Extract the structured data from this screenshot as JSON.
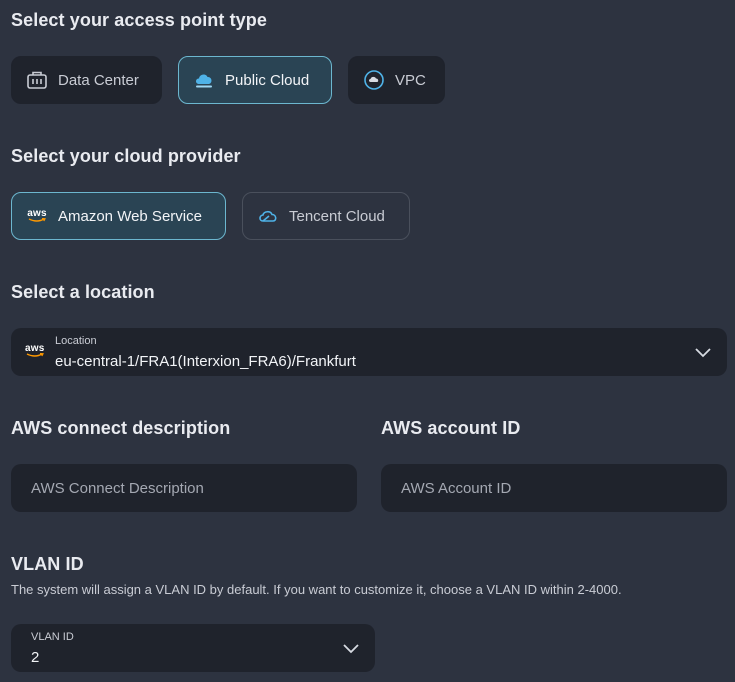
{
  "access_point": {
    "title": "Select your access point type",
    "options": [
      {
        "label": "Data Center",
        "icon": "building-icon"
      },
      {
        "label": "Public Cloud",
        "icon": "cloud-icon",
        "selected": true
      },
      {
        "label": "VPC",
        "icon": "vpc-icon"
      }
    ]
  },
  "cloud_provider": {
    "title": "Select your cloud provider",
    "options": [
      {
        "label": "Amazon Web Service",
        "icon": "aws-logo-icon",
        "selected": true
      },
      {
        "label": "Tencent Cloud",
        "icon": "tencent-cloud-icon"
      }
    ]
  },
  "location": {
    "title": "Select a location",
    "field_label": "Location",
    "value": "eu-central-1/FRA1(Interxion_FRA6)/Frankfurt",
    "logo_text": "aws"
  },
  "aws_connect": {
    "title": "AWS connect description",
    "placeholder": "AWS Connect Description",
    "value": ""
  },
  "aws_account": {
    "title": "AWS account ID",
    "placeholder": "AWS Account ID",
    "value": ""
  },
  "vlan": {
    "title": "VLAN ID",
    "helper": "The system will assign a VLAN ID by default. If you want to customize it, choose a VLAN ID within 2-4000.",
    "field_label": "VLAN ID",
    "value": "2"
  },
  "colors": {
    "background": "#2d3340",
    "field_background": "#1f232c",
    "selected_background": "#2a4454",
    "selected_border": "#6cb7cf",
    "aws_orange": "#ff9900",
    "cloud_blue": "#4fb3e8"
  }
}
